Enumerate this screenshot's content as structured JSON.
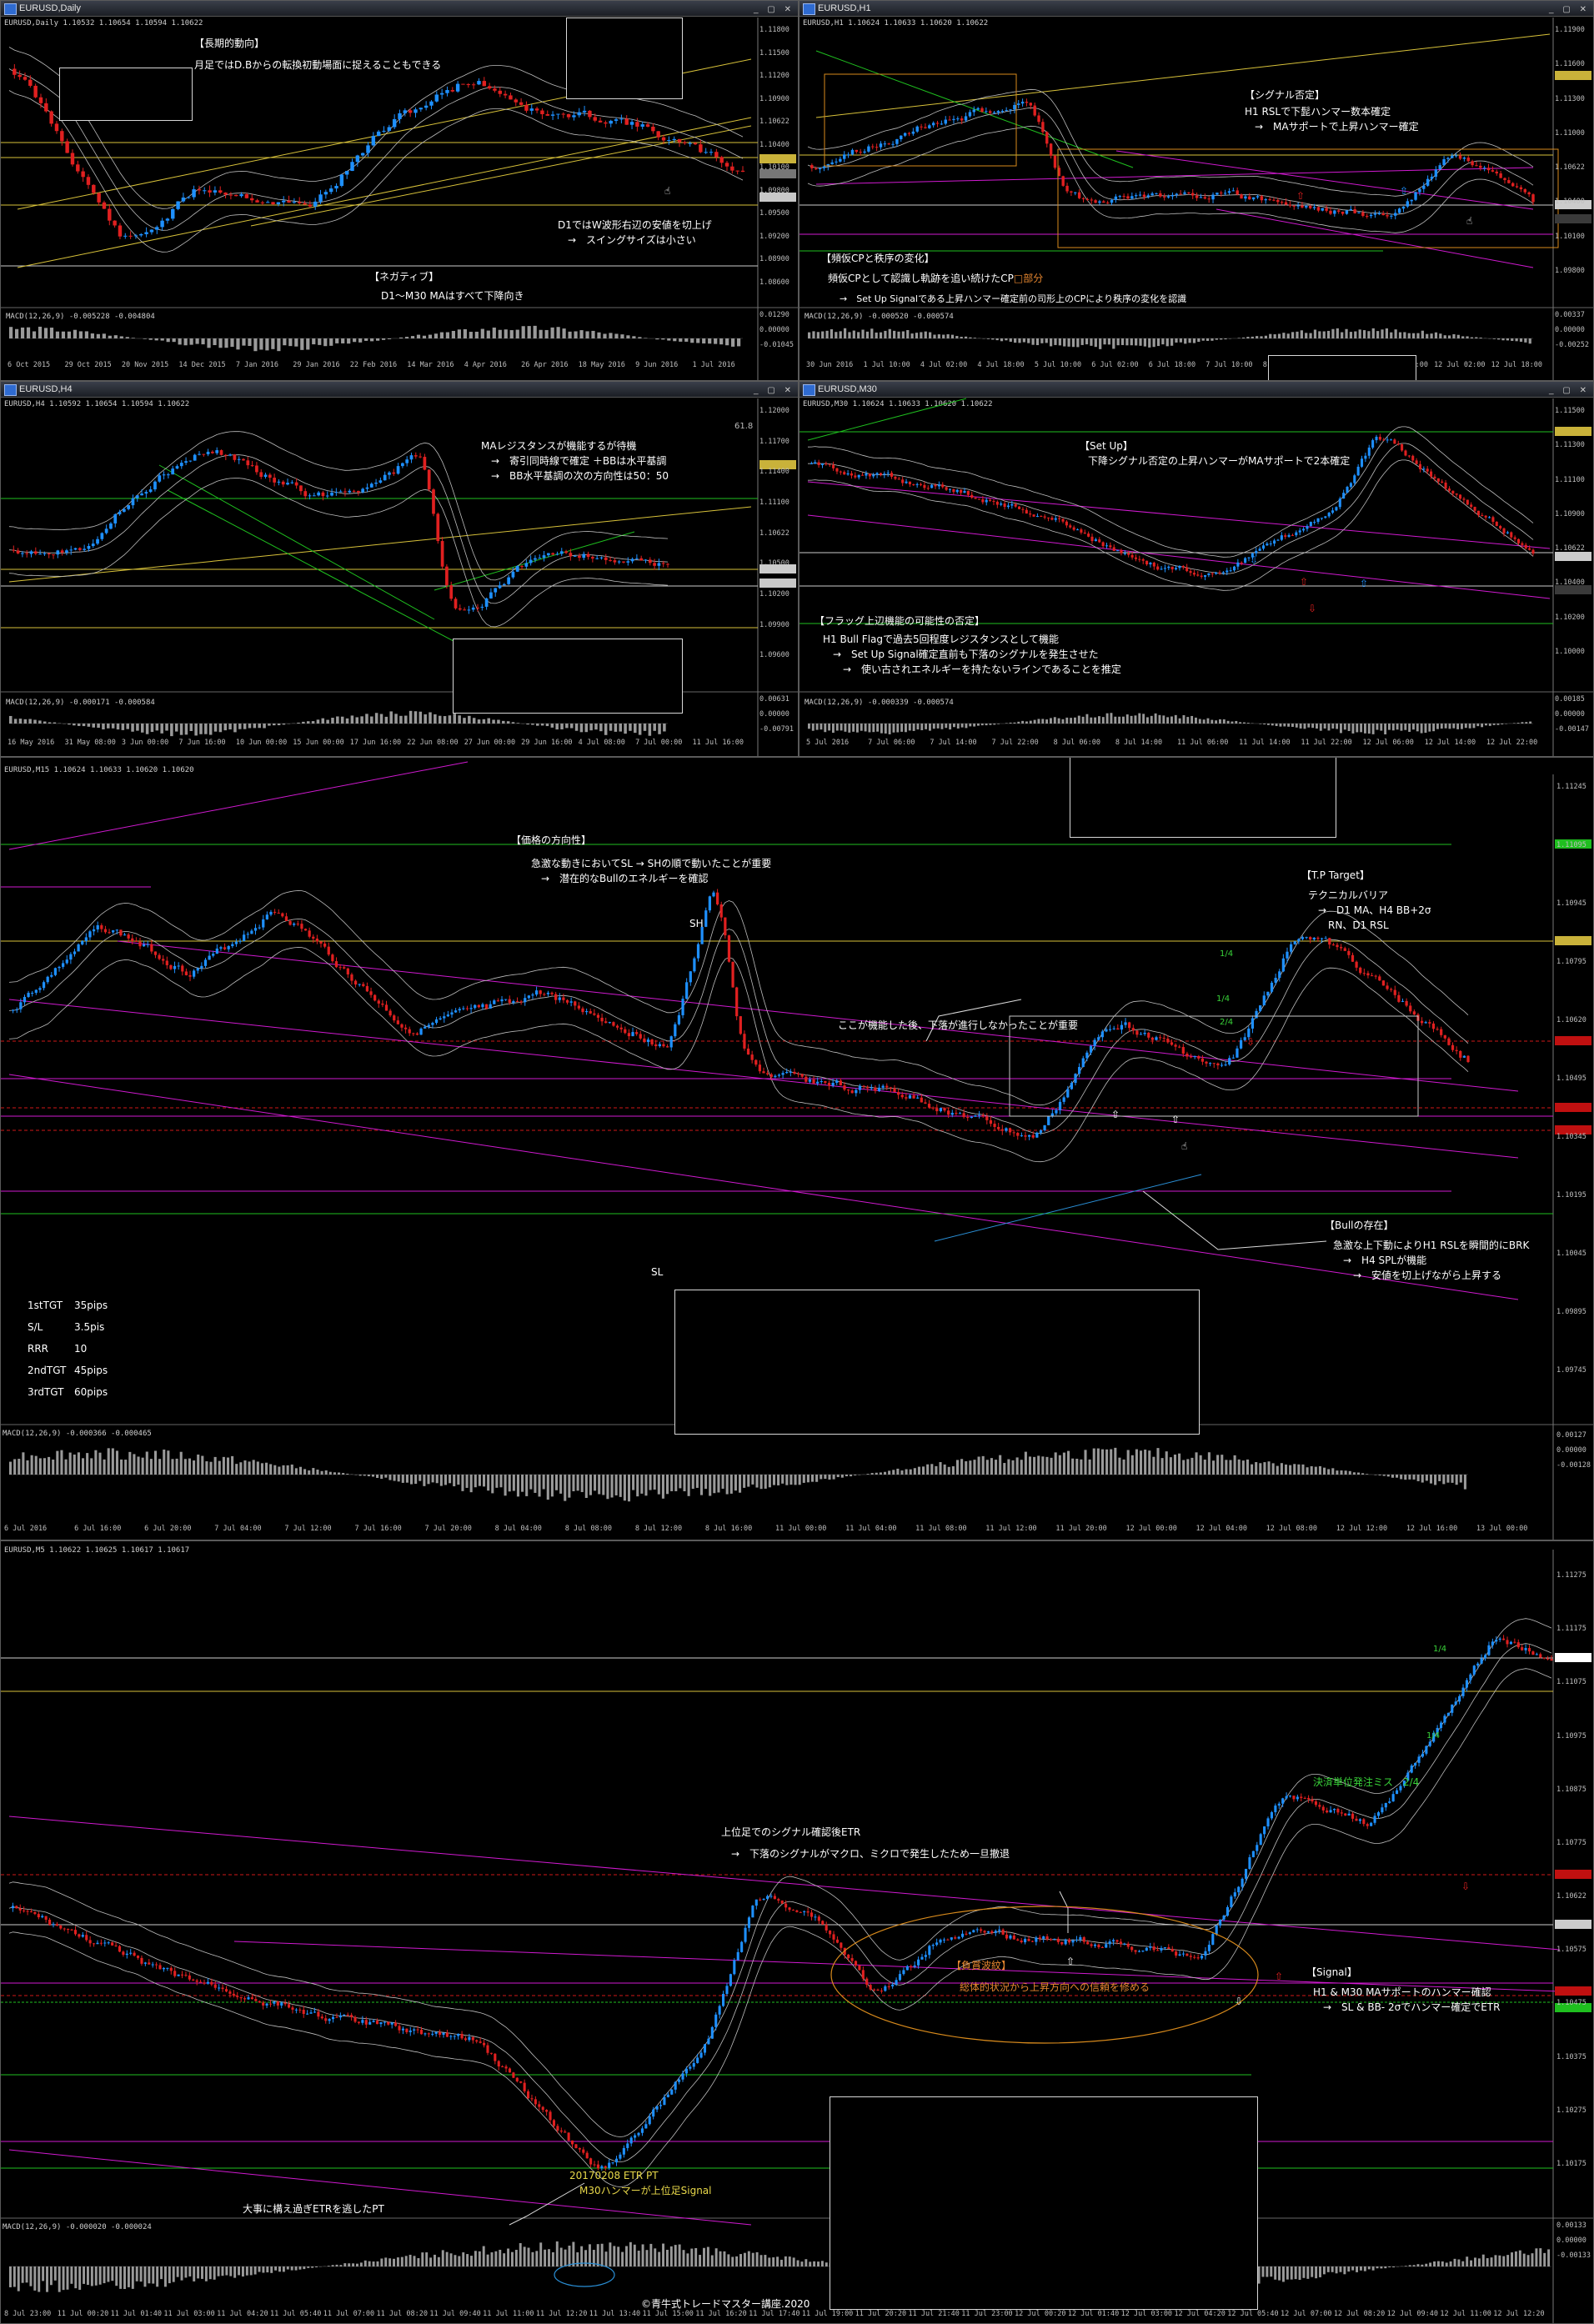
{
  "panels": {
    "daily": {
      "title": "EURUSD,Daily",
      "ohlc": "EURUSD,Daily  1.10532 1.10654 1.10594 1.10622",
      "macd": "MACD(12,26,9) -0.005228 -0.004804",
      "ann_long_h": "【長期的動向】",
      "ann_long_b": "月足ではD.Bからの転換初動場面に捉えることもできる",
      "ann_d1": "D1ではW波形右辺の安値を切上げ\n　→　スイングサイズは小さい",
      "ann_neg_h": "【ネガティブ】",
      "ann_neg_b": "D1～M30 MAはすべて下降向き",
      "prices": [
        "1.11800",
        "1.11500",
        "1.11200",
        "1.10900",
        "1.10622",
        "1.10400",
        "1.10100",
        "1.09800",
        "1.09500",
        "1.09200",
        "1.08900",
        "1.08600"
      ],
      "macd_scale": [
        "0.01290",
        "0.00000",
        "-0.01045"
      ],
      "times": [
        "6 Oct 2015",
        "29 Oct 2015",
        "20 Nov 2015",
        "14 Dec 2015",
        "7 Jan 2016",
        "29 Jan 2016",
        "22 Feb 2016",
        "14 Mar 2016",
        "4 Apr 2016",
        "26 Apr 2016",
        "18 May 2016",
        "9 Jun 2016",
        "1 Jul 2016"
      ]
    },
    "h1": {
      "title": "EURUSD,H1",
      "ohlc": "EURUSD,H1  1.10624 1.10633 1.10620 1.10622",
      "macd": "MACD(12,26,9) -0.000520 -0.000574",
      "ann_sig_h": "【シグナル否定】",
      "ann_sig_b": "H1 RSLで下髭ハンマー数本確定\n　→　MAサポートで上昇ハンマー確定",
      "ann_cp_h": "【頻仮CPと秩序の変化】",
      "ann_cp_b": "頻仮CPとして認識し軌跡を追い続けたCP",
      "ann_cp_red": "□部分",
      "ann_cp_c": "→　Set Up Signalである上昇ハンマー確定前の司形上のCPにより秩序の変化を認識",
      "prices": [
        "1.11900",
        "1.11600",
        "1.11300",
        "1.11000",
        "1.10622",
        "1.10400",
        "1.10100",
        "1.09800"
      ],
      "macd_scale": [
        "0.00337",
        "0.00000",
        "-0.00252"
      ],
      "times": [
        "30 Jun 2016",
        "1 Jul 10:00",
        "4 Jul 02:00",
        "4 Jul 18:00",
        "5 Jul 10:00",
        "6 Jul 02:00",
        "6 Jul 18:00",
        "7 Jul 10:00",
        "8 Jul 02:00",
        "8 Jul 18:00",
        "11 Jul 10:00",
        "12 Jul 02:00",
        "12 Jul 18:00"
      ]
    },
    "h4": {
      "title": "EURUSD,H4",
      "ohlc": "EURUSD,H4  1.10592 1.10654 1.10594 1.10622",
      "macd": "MACD(12,26,9) -0.000171 -0.000584",
      "ann_ma": "MAレジスタンスが機能するが待機\n　→　寄引同時線で確定 ＋BBは水平基調\n　→　BB水平基調の次の方向性は50：50",
      "level_label": "61.8",
      "prices": [
        "1.12000",
        "1.11700",
        "1.11400",
        "1.11100",
        "1.10622",
        "1.10500",
        "1.10200",
        "1.09900",
        "1.09600"
      ],
      "macd_scale": [
        "0.00631",
        "0.00000",
        "-0.00791"
      ],
      "times": [
        "16 May 2016",
        "31 May 08:00",
        "3 Jun 00:00",
        "7 Jun 16:00",
        "10 Jun 00:00",
        "15 Jun 00:00",
        "17 Jun 16:00",
        "22 Jun 08:00",
        "27 Jun 00:00",
        "29 Jun 16:00",
        "4 Jul 08:00",
        "7 Jul 00:00",
        "11 Jul 16:00"
      ]
    },
    "m30": {
      "title": "EURUSD,M30",
      "ohlc": "EURUSD,M30  1.10624 1.10633 1.10620 1.10622",
      "macd": "MACD(12,26,9) -0.000339 -0.000574",
      "ann_setup_h": "【Set Up】",
      "ann_setup_b": "下降シグナル否定の上昇ハンマーがMAサポートで2本確定",
      "ann_flag_h": "【フラッグ上辺機能の可能性の否定】",
      "ann_flag_b": "H1 Bull Flagで過去5回程度レジスタンスとして機能\n　→　Set Up Signal確定直前も下落のシグナルを発生させた\n　　→　使い古されエネルギーを持たないラインであることを推定",
      "prices": [
        "1.11500",
        "1.11300",
        "1.11100",
        "1.10900",
        "1.10622",
        "1.10400",
        "1.10200",
        "1.10000"
      ],
      "macd_scale": [
        "0.00185",
        "0.00000",
        "-0.00147"
      ],
      "times": [
        "5 Jul 2016",
        "7 Jul 06:00",
        "7 Jul 14:00",
        "7 Jul 22:00",
        "8 Jul 06:00",
        "8 Jul 14:00",
        "11 Jul 06:00",
        "11 Jul 14:00",
        "11 Jul 22:00",
        "12 Jul 06:00",
        "12 Jul 14:00",
        "12 Jul 22:00"
      ]
    },
    "m15": {
      "title": "EURUSD,M15",
      "ohlc": "EURUSD,M15  1.10624 1.10633 1.10620 1.10620",
      "macd": "MACD(12,26,9) -0.000366 -0.000465",
      "ann_dir_h": "【価格の方向性】",
      "ann_dir_b": "急激な動きにおいてSL → SHの順で動いたことが重要\n　→　潜在的なBullのエネルギーを確認",
      "ann_sh": "SH",
      "ann_sl": "SL",
      "ann_tp_h": "【T.P Target】",
      "ann_tp_b": "テクニカルバリア\n　→　D1 MA、H4 BB+2σ\n　　RN、D1 RSL",
      "ann_after": "ここが機能した後、下落が進行しなかったことが重要",
      "ann_bull_h": "【Bullの存在】",
      "ann_bull_b": "急激な上下動によりH1 RSLを瞬間的にBRK\n　→　H4 SPLが機能\n　　→　安値を切上げながら上昇する",
      "frac1": "1/4",
      "frac2": "1/4",
      "frac3": "2/4",
      "stats": [
        {
          "k": "1stTGT",
          "v": "35pips"
        },
        {
          "k": "S/L",
          "v": "3.5pis"
        },
        {
          "k": "RRR",
          "v": "10"
        },
        {
          "k": "2ndTGT",
          "v": "45pips"
        },
        {
          "k": "3rdTGT",
          "v": "60pips"
        }
      ],
      "prices": [
        "1.11245",
        "1.11095",
        "1.10945",
        "1.10795",
        "1.10620",
        "1.10495",
        "1.10345",
        "1.10195",
        "1.10045",
        "1.09895",
        "1.09745"
      ],
      "macd_scale": [
        "0.00127",
        "0.00000",
        "-0.00128"
      ],
      "times": [
        "6 Jul 2016",
        "6 Jul 16:00",
        "6 Jul 20:00",
        "7 Jul 04:00",
        "7 Jul 12:00",
        "7 Jul 16:00",
        "7 Jul 20:00",
        "8 Jul 04:00",
        "8 Jul 08:00",
        "8 Jul 12:00",
        "8 Jul 16:00",
        "11 Jul 00:00",
        "11 Jul 04:00",
        "11 Jul 08:00",
        "11 Jul 12:00",
        "11 Jul 20:00",
        "12 Jul 00:00",
        "12 Jul 04:00",
        "12 Jul 08:00",
        "12 Jul 12:00",
        "12 Jul 16:00",
        "13 Jul 00:00"
      ]
    },
    "m5": {
      "title": "EURUSD,M5",
      "ohlc": "EURUSD,M5  1.10622 1.10625 1.10617 1.10617",
      "macd": "MACD(12,26,9) -0.000020 -0.000024",
      "ann_etr_h": "上位足でのシグナル確認後ETR",
      "ann_etr_b": "→　下落のシグナルがマクロ、ミクロで発生したため一旦撤退",
      "ann_neg_h": "【負賞波紋】",
      "ann_neg_b": "総体的状況から上昇方向への信頼を修める",
      "ann_mistake": "決済単位発注ミス　2/4",
      "ann_signal_h": "【Signal】",
      "ann_signal_b": "H1 & M30 MAサポートのハンマー確認\n　→　SL & BB- 2σでハンマー確定でETR",
      "ann_pt": "20170208 ETR PT\n　M30ハンマーが上位足Signal",
      "ann_big": "大事に構え過ぎETRを逃したPT",
      "frac1": "1/4",
      "frac2": "1/4",
      "copyright": "©青牛式トレードマスター講座.2020",
      "prices": [
        "1.11275",
        "1.11175",
        "1.11075",
        "1.10975",
        "1.10875",
        "1.10775",
        "1.10622",
        "1.10575",
        "1.10475",
        "1.10375",
        "1.10275",
        "1.10175"
      ],
      "macd_scale": [
        "0.00133",
        "0.00000",
        "-0.00133"
      ],
      "times": [
        "8 Jul 23:00",
        "11 Jul 00:20",
        "11 Jul 01:40",
        "11 Jul 03:00",
        "11 Jul 04:20",
        "11 Jul 05:40",
        "11 Jul 07:00",
        "11 Jul 08:20",
        "11 Jul 09:40",
        "11 Jul 11:00",
        "11 Jul 12:20",
        "11 Jul 13:40",
        "11 Jul 15:00",
        "11 Jul 16:20",
        "11 Jul 17:40",
        "11 Jul 19:00",
        "11 Jul 20:20",
        "11 Jul 21:40",
        "11 Jul 23:00",
        "12 Jul 00:20",
        "12 Jul 01:40",
        "12 Jul 03:00",
        "12 Jul 04:20",
        "12 Jul 05:40",
        "12 Jul 07:00",
        "12 Jul 08:20",
        "12 Jul 09:40",
        "12 Jul 11:00",
        "12 Jul 12:20"
      ]
    }
  },
  "colors": {
    "bull": "#1e90ff",
    "bear": "#e02020",
    "bb": "#bdbdbd",
    "magenta": "#d01ad0",
    "yellow": "#d8c23a",
    "green": "#1fbf1f",
    "red_dash": "#d01818",
    "macd": "#9a9a9a"
  }
}
